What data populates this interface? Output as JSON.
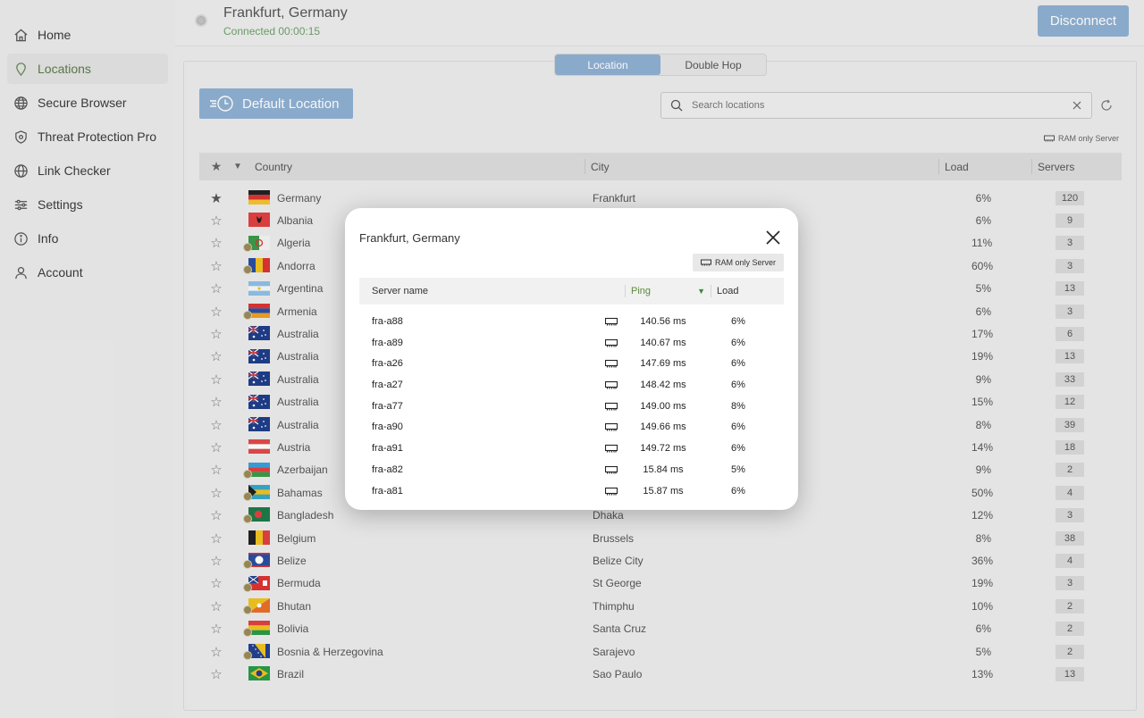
{
  "sidebar": {
    "items": [
      {
        "label": "Home",
        "icon": "home-icon"
      },
      {
        "label": "Locations",
        "icon": "location-pin-icon"
      },
      {
        "label": "Secure Browser",
        "icon": "globe-icon"
      },
      {
        "label": "Threat Protection Pro",
        "icon": "shield-icon"
      },
      {
        "label": "Link Checker",
        "icon": "globe-link-icon"
      },
      {
        "label": "Settings",
        "icon": "sliders-icon"
      },
      {
        "label": "Info",
        "icon": "info-icon"
      },
      {
        "label": "Account",
        "icon": "person-icon"
      }
    ],
    "active_index": 1
  },
  "header": {
    "title": "Frankfurt, Germany",
    "status": "Connected 00:00:15",
    "disconnect_label": "Disconnect"
  },
  "tabs": [
    {
      "label": "Location",
      "active": true
    },
    {
      "label": "Double Hop",
      "active": false
    }
  ],
  "default_location_label": "Default Location",
  "search": {
    "placeholder": "Search locations",
    "value": ""
  },
  "ram_legend": "RAM only Server",
  "table": {
    "headers": {
      "country": "Country",
      "city": "City",
      "load": "Load",
      "servers": "Servers"
    },
    "rows": [
      {
        "country": "Germany",
        "city": "Frankfurt",
        "load": "6%",
        "servers": "120",
        "favorite": true,
        "virtual": false,
        "flag": "de"
      },
      {
        "country": "Albania",
        "city": "",
        "load": "6%",
        "servers": "9",
        "favorite": false,
        "virtual": false,
        "flag": "al"
      },
      {
        "country": "Algeria",
        "city": "",
        "load": "11%",
        "servers": "3",
        "favorite": false,
        "virtual": true,
        "flag": "dz"
      },
      {
        "country": "Andorra",
        "city": "",
        "load": "60%",
        "servers": "3",
        "favorite": false,
        "virtual": true,
        "flag": "ad"
      },
      {
        "country": "Argentina",
        "city": "",
        "load": "5%",
        "servers": "13",
        "favorite": false,
        "virtual": false,
        "flag": "ar"
      },
      {
        "country": "Armenia",
        "city": "",
        "load": "6%",
        "servers": "3",
        "favorite": false,
        "virtual": true,
        "flag": "am"
      },
      {
        "country": "Australia",
        "city": "",
        "load": "17%",
        "servers": "6",
        "favorite": false,
        "virtual": false,
        "flag": "au"
      },
      {
        "country": "Australia",
        "city": "",
        "load": "19%",
        "servers": "13",
        "favorite": false,
        "virtual": false,
        "flag": "au"
      },
      {
        "country": "Australia",
        "city": "",
        "load": "9%",
        "servers": "33",
        "favorite": false,
        "virtual": false,
        "flag": "au"
      },
      {
        "country": "Australia",
        "city": "",
        "load": "15%",
        "servers": "12",
        "favorite": false,
        "virtual": false,
        "flag": "au"
      },
      {
        "country": "Australia",
        "city": "",
        "load": "8%",
        "servers": "39",
        "favorite": false,
        "virtual": false,
        "flag": "au"
      },
      {
        "country": "Austria",
        "city": "",
        "load": "14%",
        "servers": "18",
        "favorite": false,
        "virtual": false,
        "flag": "at"
      },
      {
        "country": "Azerbaijan",
        "city": "",
        "load": "9%",
        "servers": "2",
        "favorite": false,
        "virtual": true,
        "flag": "az"
      },
      {
        "country": "Bahamas",
        "city": "",
        "load": "50%",
        "servers": "4",
        "favorite": false,
        "virtual": true,
        "flag": "bs"
      },
      {
        "country": "Bangladesh",
        "city": "Dhaka",
        "load": "12%",
        "servers": "3",
        "favorite": false,
        "virtual": true,
        "flag": "bd"
      },
      {
        "country": "Belgium",
        "city": "Brussels",
        "load": "8%",
        "servers": "38",
        "favorite": false,
        "virtual": false,
        "flag": "be"
      },
      {
        "country": "Belize",
        "city": "Belize City",
        "load": "36%",
        "servers": "4",
        "favorite": false,
        "virtual": true,
        "flag": "bz"
      },
      {
        "country": "Bermuda",
        "city": "St George",
        "load": "19%",
        "servers": "3",
        "favorite": false,
        "virtual": true,
        "flag": "bm"
      },
      {
        "country": "Bhutan",
        "city": "Thimphu",
        "load": "10%",
        "servers": "2",
        "favorite": false,
        "virtual": true,
        "flag": "bt"
      },
      {
        "country": "Bolivia",
        "city": "Santa Cruz",
        "load": "6%",
        "servers": "2",
        "favorite": false,
        "virtual": true,
        "flag": "bo"
      },
      {
        "country": "Bosnia & Herzegovina",
        "city": "Sarajevo",
        "load": "5%",
        "servers": "2",
        "favorite": false,
        "virtual": true,
        "flag": "ba"
      },
      {
        "country": "Brazil",
        "city": "Sao Paulo",
        "load": "13%",
        "servers": "13",
        "favorite": false,
        "virtual": false,
        "flag": "br"
      }
    ]
  },
  "modal": {
    "title": "Frankfurt, Germany",
    "ram_badge": "RAM only Server",
    "headers": {
      "name": "Server name",
      "ping": "Ping",
      "load": "Load"
    },
    "servers": [
      {
        "name": "fra-a88",
        "ping": "140.56 ms",
        "load": "6%"
      },
      {
        "name": "fra-a89",
        "ping": "140.67 ms",
        "load": "6%"
      },
      {
        "name": "fra-a26",
        "ping": "147.69 ms",
        "load": "6%"
      },
      {
        "name": "fra-a27",
        "ping": "148.42 ms",
        "load": "6%"
      },
      {
        "name": "fra-a77",
        "ping": "149.00 ms",
        "load": "8%"
      },
      {
        "name": "fra-a90",
        "ping": "149.66 ms",
        "load": "6%"
      },
      {
        "name": "fra-a91",
        "ping": "149.72 ms",
        "load": "6%"
      },
      {
        "name": "fra-a82",
        "ping": "15.84 ms",
        "load": "5%"
      },
      {
        "name": "fra-a81",
        "ping": "15.87 ms",
        "load": "6%"
      }
    ]
  },
  "colors": {
    "accent": "#8fb0d2",
    "connected": "#6fa06a",
    "active_nav": "#5a7a4a"
  }
}
